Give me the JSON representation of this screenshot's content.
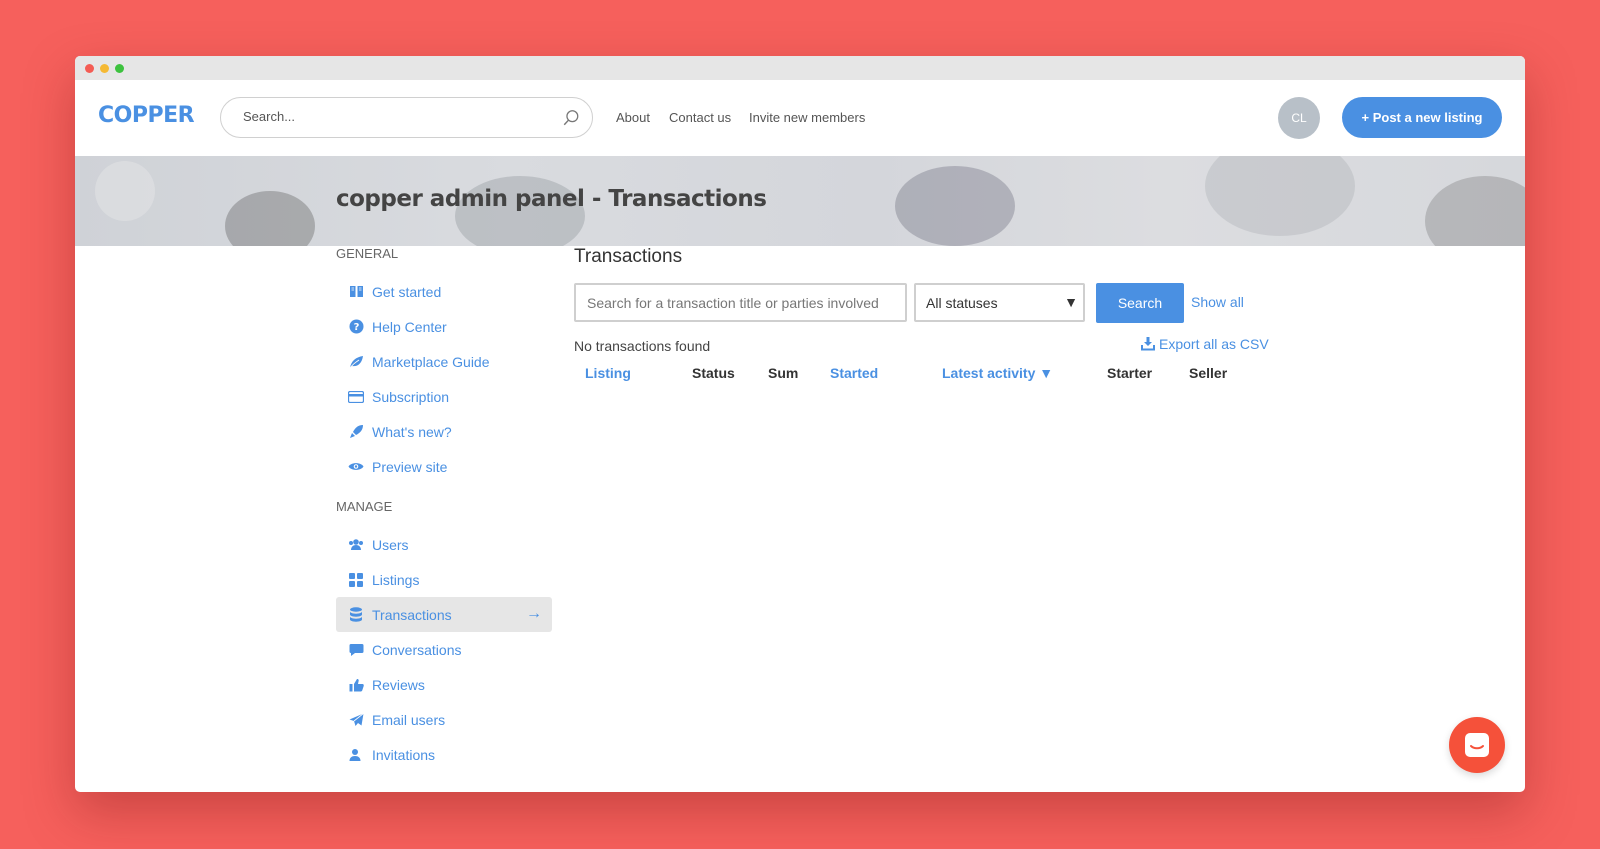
{
  "brand": {
    "logo": "COPPER"
  },
  "header": {
    "search_placeholder": "Search...",
    "nav": [
      "About",
      "Contact us",
      "Invite new members"
    ],
    "avatar_initials": "CL",
    "post_button": "+ Post a new listing"
  },
  "page_title": "copper admin panel - Transactions",
  "sidebar": {
    "general_heading": "GENERAL",
    "general_items": [
      {
        "label": "Get started",
        "icon": "book-icon"
      },
      {
        "label": "Help Center",
        "icon": "question-circle-icon"
      },
      {
        "label": "Marketplace Guide",
        "icon": "leaf-icon"
      },
      {
        "label": "Subscription",
        "icon": "credit-card-icon"
      },
      {
        "label": "What's new?",
        "icon": "rocket-icon"
      },
      {
        "label": "Preview site",
        "icon": "eye-icon"
      }
    ],
    "manage_heading": "MANAGE",
    "manage_items": [
      {
        "label": "Users",
        "icon": "users-icon"
      },
      {
        "label": "Listings",
        "icon": "grid-icon"
      },
      {
        "label": "Transactions",
        "icon": "database-icon",
        "active": true
      },
      {
        "label": "Conversations",
        "icon": "chat-bubble-icon"
      },
      {
        "label": "Reviews",
        "icon": "thumbs-up-icon"
      },
      {
        "label": "Email users",
        "icon": "paper-plane-icon"
      },
      {
        "label": "Invitations",
        "icon": "user-plus-icon"
      }
    ]
  },
  "main": {
    "heading": "Transactions",
    "search_placeholder": "Search for a transaction title or parties involved",
    "status_select": "All statuses",
    "search_button": "Search",
    "show_all": "Show all",
    "empty_message": "No transactions found",
    "export_label": "Export all as CSV",
    "columns": [
      "Listing",
      "Status",
      "Sum",
      "Started",
      "Latest activity ▼",
      "Starter",
      "Seller"
    ]
  },
  "colors": {
    "accent": "#4a90e2",
    "background": "#f6605c",
    "intercom": "#f5513a"
  }
}
